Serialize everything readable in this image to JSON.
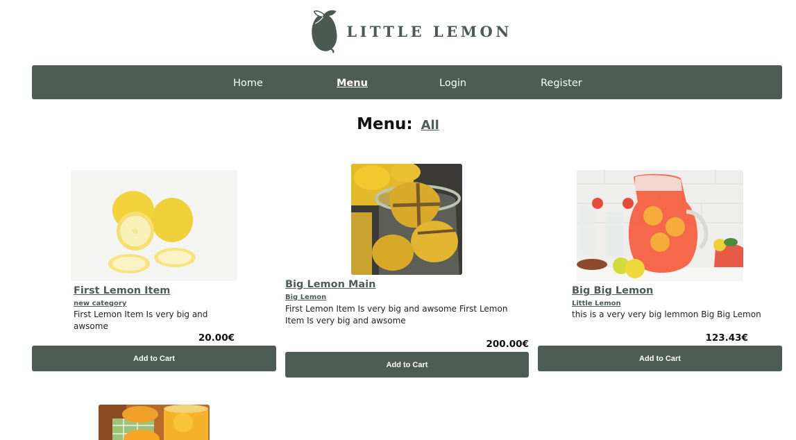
{
  "brand": {
    "name": "LITTLE LEMON",
    "color": "#4a5a52"
  },
  "nav": {
    "items": [
      {
        "label": "Home",
        "active": false
      },
      {
        "label": "Menu",
        "active": true
      },
      {
        "label": "Login",
        "active": false
      },
      {
        "label": "Register",
        "active": false
      }
    ],
    "background": "#4d5d56"
  },
  "heading": {
    "label": "Menu:",
    "filter": "All"
  },
  "items": [
    {
      "title": "First Lemon Item",
      "category": "new category",
      "description": "First Lemon Item Is very big and awsome",
      "price": "20.00",
      "currency": "€",
      "button": "Add to Cart",
      "image": "lemons-on-white-image"
    },
    {
      "title": "Big Lemon Main",
      "category": "Big Lemon",
      "description": "First Lemon Item Is very big and awsome First Lemon Item Is very big and awsome",
      "price": "200.00",
      "currency": "€",
      "button": "Add to Cart",
      "image": "preserved-lemons-jar-image"
    },
    {
      "title": "Big Big Lemon",
      "category": "Little Lemon",
      "description": "this is a very very big lemmon Big Big Lemon",
      "price": "123.43",
      "currency": "€",
      "button": "Add to Cart",
      "image": "lemonade-pitcher-image"
    }
  ],
  "partial_item": {
    "image": "lemon-curd-jars-image"
  }
}
